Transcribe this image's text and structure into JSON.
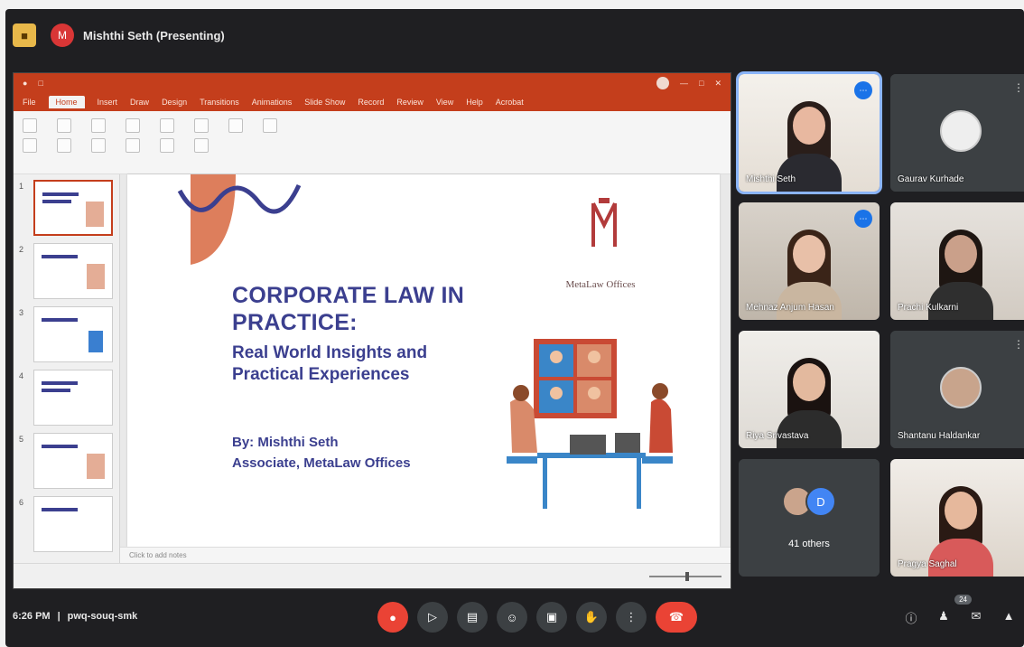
{
  "topbar": {
    "presenter_label": "Mishthi Seth (Presenting)",
    "presenter_initial": "M"
  },
  "ppt": {
    "tabs": [
      "File",
      "Home",
      "Insert",
      "Draw",
      "Design",
      "Transitions",
      "Animations",
      "Slide Show",
      "Record",
      "Review",
      "View",
      "Help",
      "Acrobat"
    ],
    "notes_placeholder": "Click to add notes",
    "thumb_numbers": [
      "1",
      "2",
      "3",
      "4",
      "5",
      "6"
    ]
  },
  "slide": {
    "title": "CORPORATE LAW IN PRACTICE:",
    "subtitle": "Real World Insights and Practical Experiences",
    "by_line": "By: Mishthi Seth",
    "role_line": "Associate, MetaLaw Offices",
    "logo_text": "MetaLaw Offices",
    "logo_initial": "M"
  },
  "participants": [
    {
      "name": "Mishthi Seth",
      "speaking": true
    },
    {
      "name": "Gaurav Kurhade",
      "speaking": false
    },
    {
      "name": "Mehnaz Anjum Hasan",
      "speaking": false
    },
    {
      "name": "Prachi Kulkarni",
      "speaking": false
    },
    {
      "name": "Riya Srivastava",
      "speaking": false
    },
    {
      "name": "Shantanu Haldankar",
      "speaking": false
    },
    {
      "name": "41 others",
      "speaking": false
    },
    {
      "name": "Pragya Saghal",
      "speaking": false
    }
  ],
  "others_initial": "D",
  "bottombar": {
    "time": "6:26 PM",
    "meeting_code": "pwq-souq-smk",
    "chat_badge": "24"
  },
  "colors": {
    "ppt_accent": "#c43e1c",
    "slide_text": "#3b3f8f",
    "end_call": "#ea4335",
    "active_speaker": "#8ab4f8"
  }
}
